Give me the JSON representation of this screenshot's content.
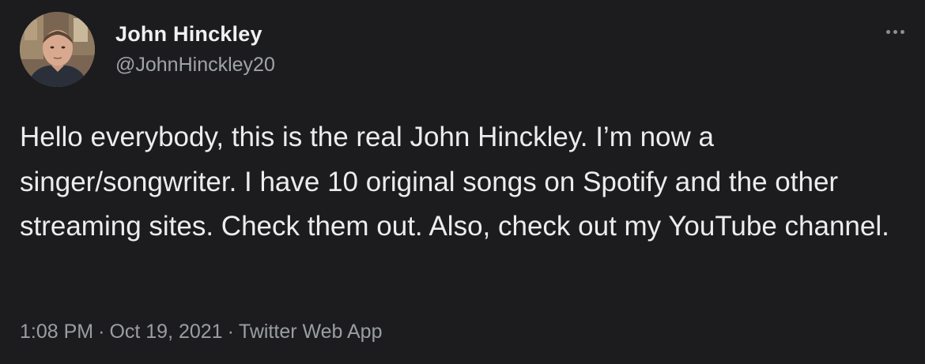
{
  "tweet": {
    "author": {
      "display_name": "John Hinckley",
      "handle": "@JohnHinckley20",
      "avatar_icon": "user-avatar"
    },
    "more_icon": "more-horizontal-icon",
    "text": "Hello everybody, this is the real John Hinckley. I’m now a singer/songwriter. I have 10 original songs on Spotify and the other streaming sites. Check them out. Also, check out my YouTube channel.",
    "meta": {
      "time": "1:08 PM",
      "separator": "·",
      "date": "Oct 19, 2021",
      "source": "Twitter Web App"
    }
  },
  "colors": {
    "background": "#1c1c1e",
    "primary_text": "#e7e9ea",
    "secondary_text": "#9a9ea3"
  }
}
